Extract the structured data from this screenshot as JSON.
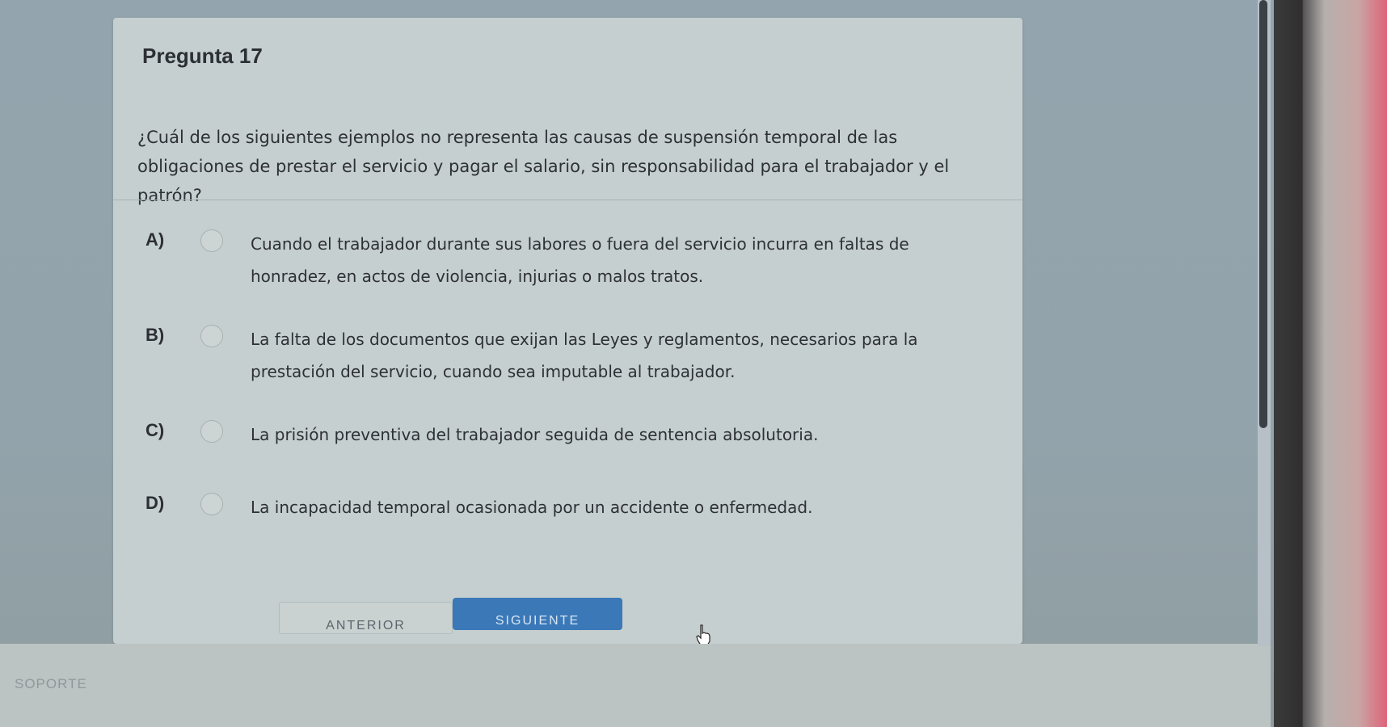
{
  "question_card": {
    "title": "Pregunta 17",
    "question_text": "¿Cuál de los siguientes ejemplos no representa las causas de suspensión temporal de las obligaciones de prestar el servicio y pagar el salario, sin responsabilidad para el trabajador y el patrón?",
    "options": [
      {
        "letter": "A)",
        "text": "Cuando el trabajador durante sus labores o fuera del servicio incurra en faltas de honradez, en actos de violencia, injurias o malos tratos.",
        "selected": false
      },
      {
        "letter": "B)",
        "text": "La falta de los documentos que exijan las Leyes y reglamentos, necesarios para la prestación del servicio, cuando sea imputable al trabajador.",
        "selected": false
      },
      {
        "letter": "C)",
        "text": "La prisión preventiva del trabajador seguida de sentencia absolutoria.",
        "selected": false
      },
      {
        "letter": "D)",
        "text": "La incapacidad temporal ocasionada por un accidente o enfermedad.",
        "selected": false
      }
    ]
  },
  "navigation": {
    "prev_label": "ANTERIOR",
    "next_label": "SIGUIENTE"
  },
  "footer": {
    "support_label": "SOPORTE"
  },
  "colors": {
    "card_background": "#c6cfcf",
    "primary_button": "#3b78b8",
    "page_background": "#93a4ae"
  },
  "icons": {
    "radio": "radio-unchecked-icon",
    "cursor": "hand-pointer-icon"
  }
}
